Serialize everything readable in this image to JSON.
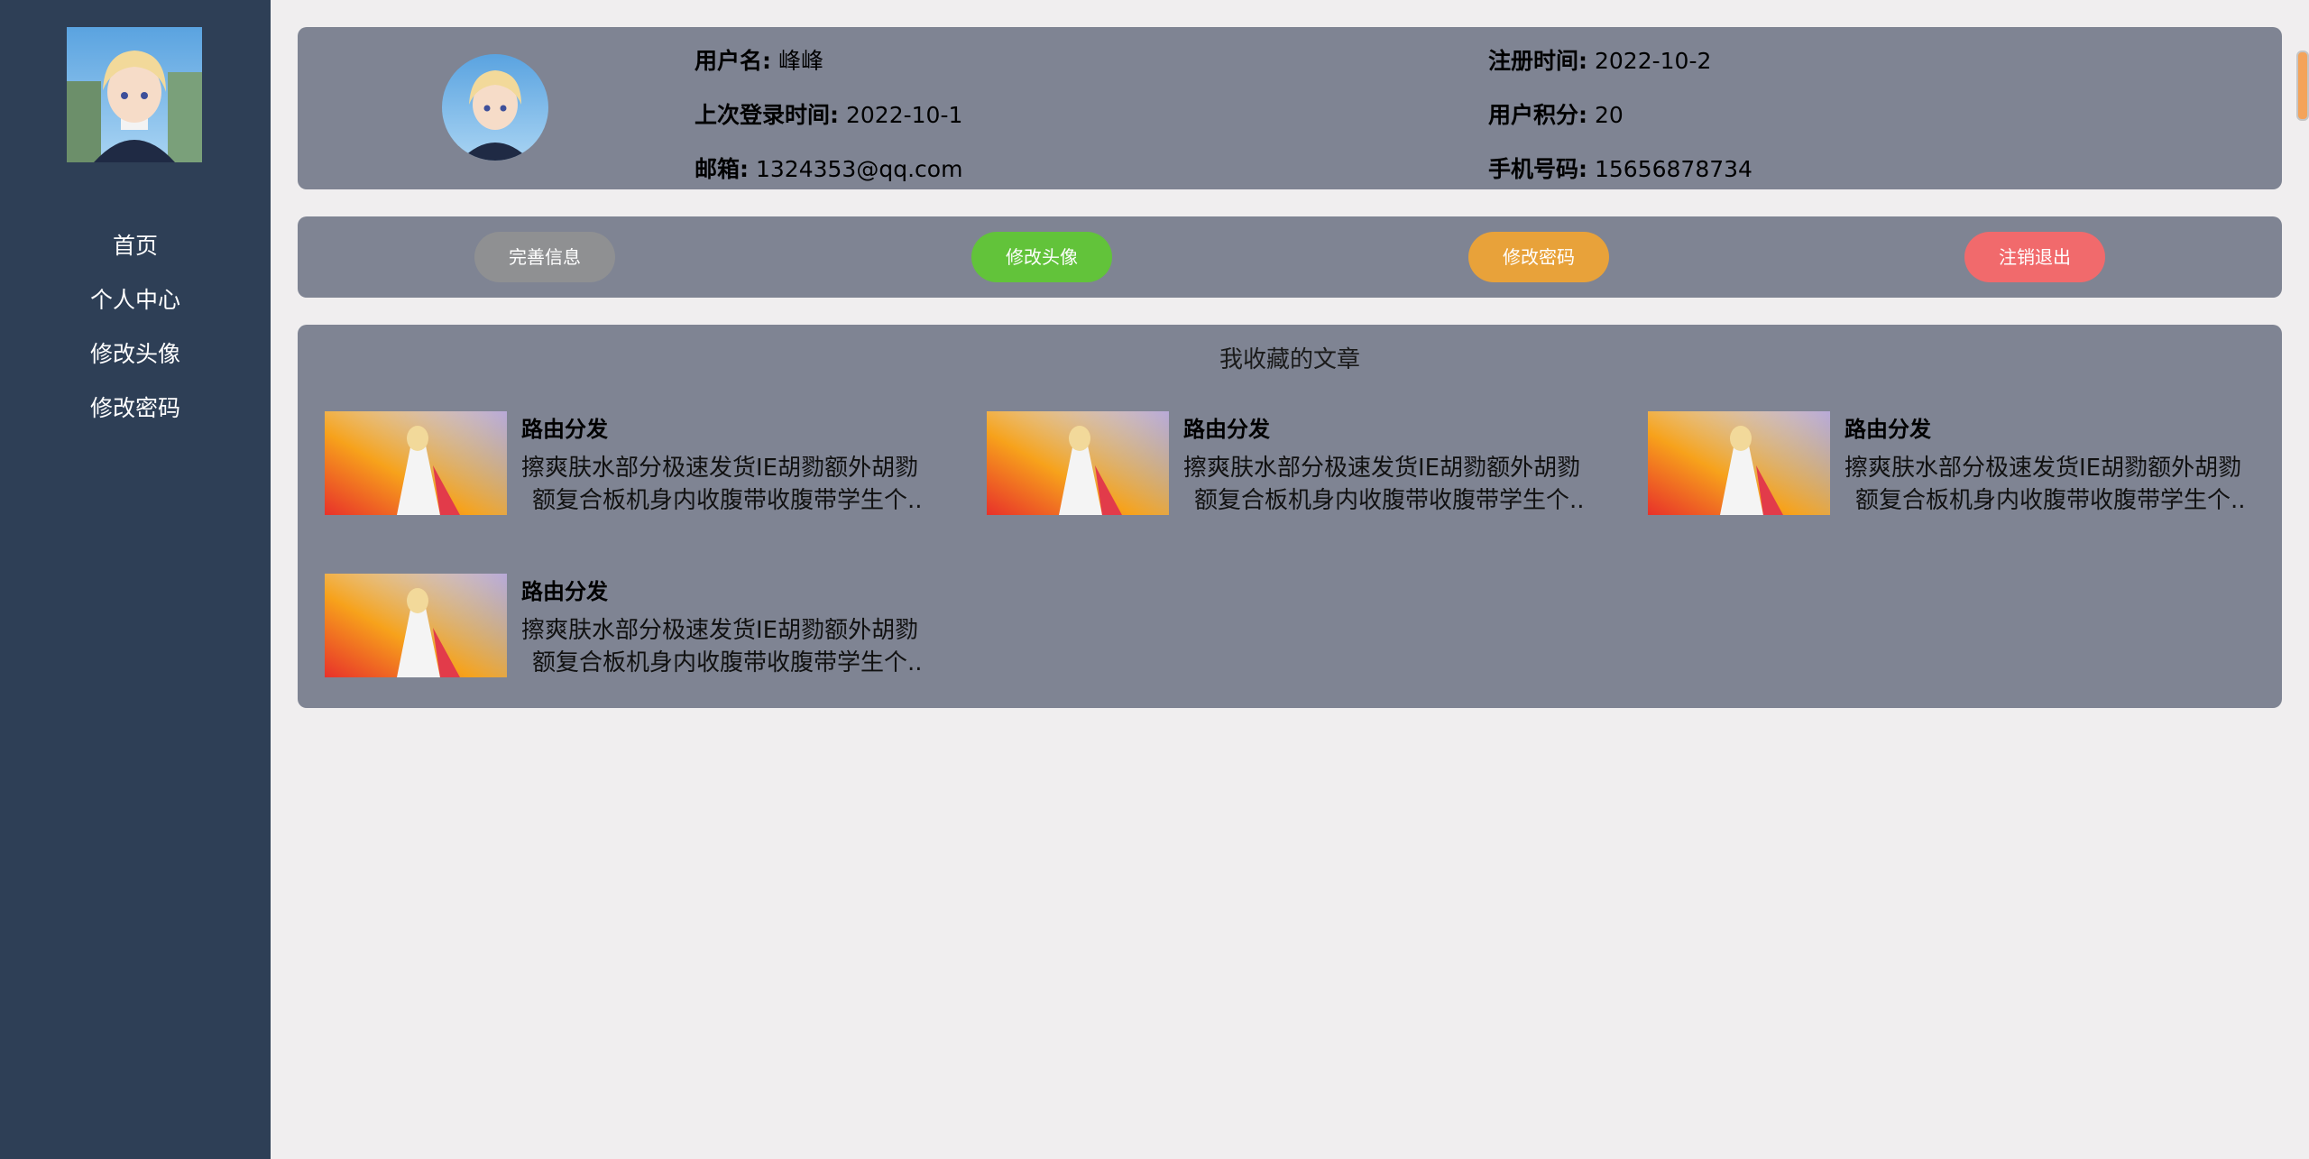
{
  "sidebar": {
    "nav": [
      {
        "label": "首页"
      },
      {
        "label": "个人中心"
      },
      {
        "label": "修改头像"
      },
      {
        "label": "修改密码"
      }
    ]
  },
  "profile": {
    "username_label": "用户名:",
    "username_value": "峰峰",
    "register_label": "注册时间:",
    "register_value": "2022-10-2",
    "last_login_label": "上次登录时间:",
    "last_login_value": "2022-10-1",
    "points_label": "用户积分:",
    "points_value": "20",
    "email_label": "邮箱:",
    "email_value": "1324353@qq.com",
    "phone_label": "手机号码:",
    "phone_value": "15656878734"
  },
  "actions": [
    {
      "label": "完善信息",
      "color": "#8f9092"
    },
    {
      "label": "修改头像",
      "color": "#62c33a"
    },
    {
      "label": "修改密码",
      "color": "#e8a23a"
    },
    {
      "label": "注销退出",
      "color": "#f16a6c"
    }
  ],
  "favorites": {
    "title": "我收藏的文章",
    "articles": [
      {
        "title": "路由分发",
        "line1": "擦爽肤水部分极速发货IE胡勠额外胡勠",
        "line2": "额复合板机身内收腹带收腹带学生个.."
      },
      {
        "title": "路由分发",
        "line1": "擦爽肤水部分极速发货IE胡勠额外胡勠",
        "line2": "额复合板机身内收腹带收腹带学生个.."
      },
      {
        "title": "路由分发",
        "line1": "擦爽肤水部分极速发货IE胡勠额外胡勠",
        "line2": "额复合板机身内收腹带收腹带学生个.."
      },
      {
        "title": "路由分发",
        "line1": "擦爽肤水部分极速发货IE胡勠额外胡勠",
        "line2": "额复合板机身内收腹带收腹带学生个.."
      }
    ]
  }
}
